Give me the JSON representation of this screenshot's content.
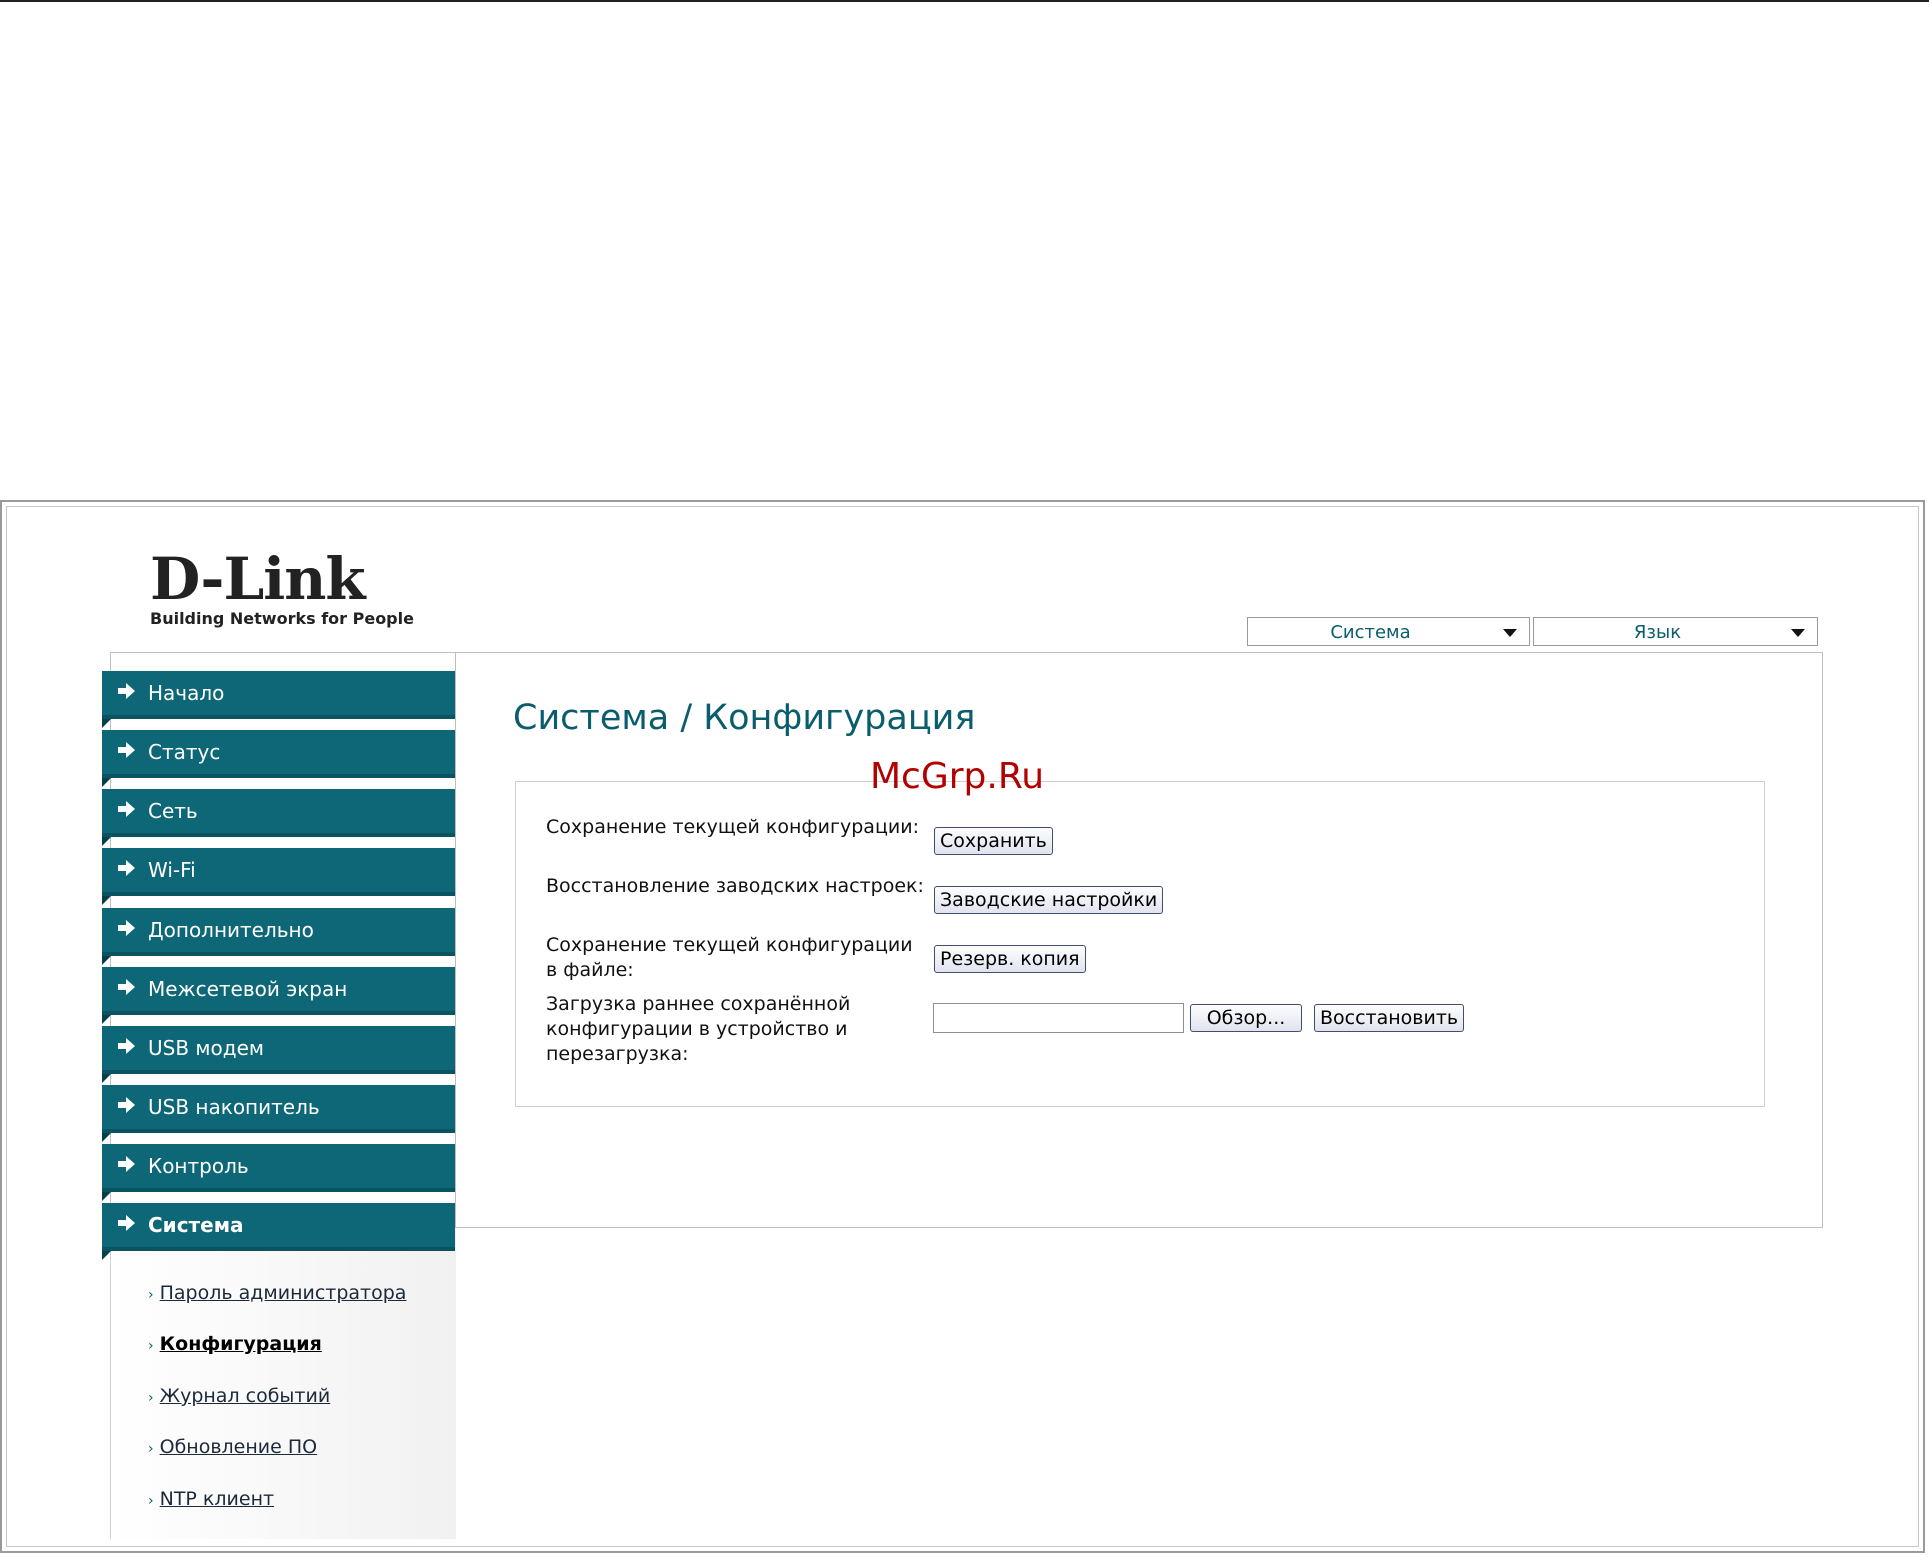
{
  "logo": {
    "brand": "D-Link",
    "tagline": "Building Networks for People"
  },
  "top_selects": [
    {
      "value": "Система"
    },
    {
      "value": "Язык"
    }
  ],
  "sidebar": {
    "items": [
      {
        "label": "Начало"
      },
      {
        "label": "Статус"
      },
      {
        "label": "Сеть"
      },
      {
        "label": "Wi-Fi"
      },
      {
        "label": "Дополнительно"
      },
      {
        "label": "Межсетевой экран"
      },
      {
        "label": "USB модем"
      },
      {
        "label": "USB накопитель"
      },
      {
        "label": "Контроль"
      },
      {
        "label": "Система"
      }
    ],
    "subitems": [
      {
        "label": "Пароль администратора"
      },
      {
        "label": "Конфигурация"
      },
      {
        "label": "Журнал событий"
      },
      {
        "label": "Обновление ПО"
      },
      {
        "label": "NTP клиент"
      }
    ],
    "bullet": "›"
  },
  "main": {
    "title": "Система / Конфигурация",
    "watermark": "McGrp.Ru",
    "rows": [
      {
        "label": "Сохранение текущей конфигурации:",
        "button": "Сохранить"
      },
      {
        "label": "Восстановление заводских настроек:",
        "button": "Заводские настройки"
      },
      {
        "label": "Сохранение текущей конфигурации в файле:",
        "button": "Резерв. копия"
      },
      {
        "label": "Загрузка раннее сохранённой конфигурации в устройство и перезагрузка:",
        "browse_button": "Обзор...",
        "restore_button": "Восстановить",
        "file_value": ""
      }
    ]
  },
  "colors": {
    "accent": "#0e6777",
    "title": "#0a5d6c",
    "watermark": "#b30000"
  }
}
